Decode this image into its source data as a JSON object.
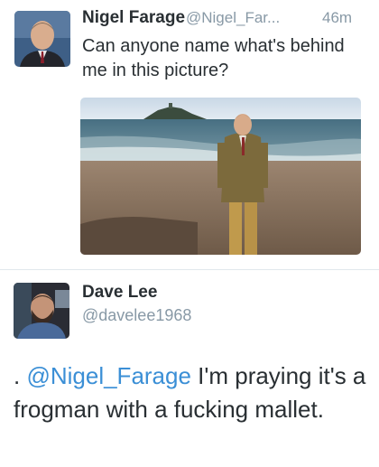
{
  "tweet1": {
    "display_name": "Nigel Farage",
    "handle": "@Nigel_Far...",
    "time": "46m",
    "text": "Can anyone name what's behind me in this picture?"
  },
  "tweet2": {
    "display_name": "Dave Lee",
    "handle": "@davelee1968",
    "text_prefix": ". ",
    "mention": "@Nigel_Farage",
    "text_suffix": " I'm praying it's a frogman with a fucking mallet."
  },
  "colors": {
    "name": "#292f33",
    "secondary": "#8899a6",
    "mention": "#3b8fd6",
    "divider": "#e1e8ed"
  },
  "icons": {
    "avatar1": "avatar-photo",
    "avatar2": "avatar-photo",
    "photo": "beach-photo"
  }
}
